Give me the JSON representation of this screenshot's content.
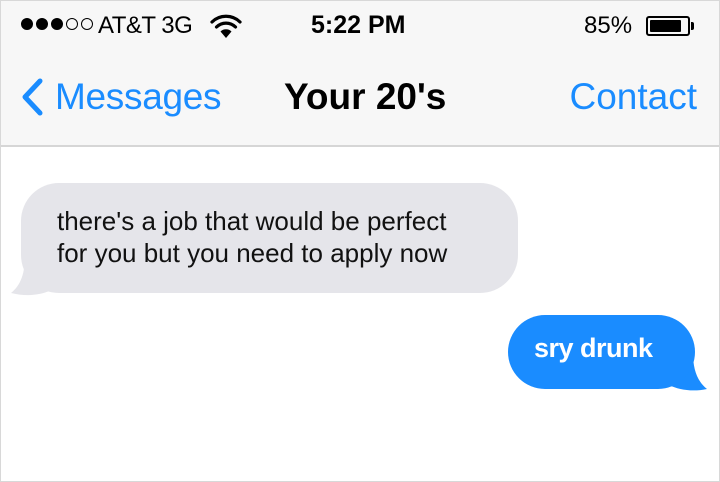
{
  "status_bar": {
    "signal_bars_filled": 3,
    "signal_bars_total": 5,
    "carrier": "AT&T 3G",
    "wifi_icon": "wifi-icon",
    "time": "5:22 PM",
    "battery_percent_label": "85%",
    "battery_level": 0.85
  },
  "nav": {
    "back_icon": "chevron-left-icon",
    "back_label": "Messages",
    "title": "Your 20's",
    "contact_label": "Contact"
  },
  "messages": [
    {
      "direction": "incoming",
      "text": "there's a job that would be perfect\nfor you but you need to apply now"
    },
    {
      "direction": "outgoing",
      "text": "sry drunk"
    }
  ],
  "colors": {
    "accent": "#1a8cff",
    "incoming_bubble": "#e5e5ea",
    "bar_background": "#f7f7f7"
  }
}
